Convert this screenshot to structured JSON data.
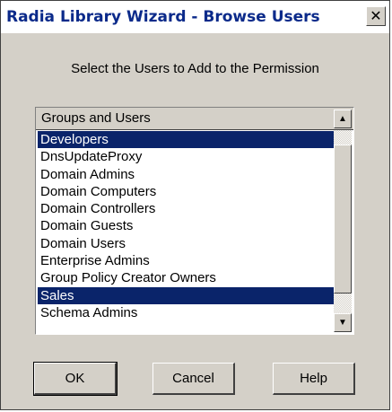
{
  "window": {
    "title": "Radia Library Wizard - Browse  Users",
    "close_glyph": "✕"
  },
  "prompt": "Select the Users to Add to the Permission",
  "list": {
    "header": "Groups and Users",
    "items": [
      {
        "label": "Developers",
        "selected": true
      },
      {
        "label": "DnsUpdateProxy",
        "selected": false
      },
      {
        "label": "Domain Admins",
        "selected": false
      },
      {
        "label": "Domain Computers",
        "selected": false
      },
      {
        "label": "Domain Controllers",
        "selected": false
      },
      {
        "label": "Domain Guests",
        "selected": false
      },
      {
        "label": "Domain Users",
        "selected": false
      },
      {
        "label": "Enterprise Admins",
        "selected": false
      },
      {
        "label": "Group Policy Creator Owners",
        "selected": false
      },
      {
        "label": "Sales",
        "selected": true
      },
      {
        "label": "Schema Admins",
        "selected": false
      }
    ],
    "scroll_up_glyph": "▲",
    "scroll_down_glyph": "▼"
  },
  "buttons": {
    "ok": "OK",
    "cancel": "Cancel",
    "help": "Help"
  }
}
